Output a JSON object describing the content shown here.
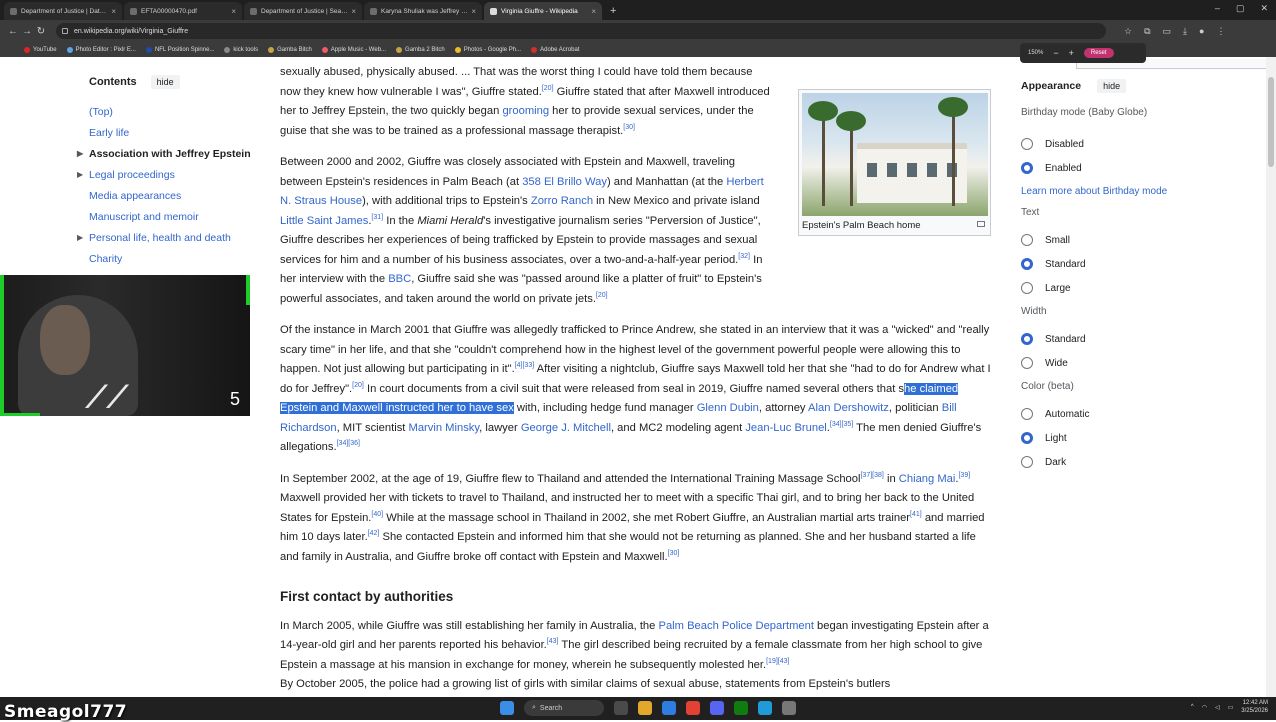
{
  "browser": {
    "tabs": [
      {
        "label": "Department of Justice | Data Set"
      },
      {
        "label": "EFTA00000470.pdf"
      },
      {
        "label": "Department of Justice | Search"
      },
      {
        "label": "Karyna Shuliak was Jeffrey Eps"
      },
      {
        "label": "Virginia Giuffre - Wikipedia",
        "active": true
      }
    ],
    "url": "en.wikipedia.org/wiki/Virginia_Giuffre",
    "bookmarks": [
      "YouTube",
      "Photo Editor : Pixlr E...",
      "NFL Position Spinne...",
      "kick tools",
      "Gamba Bitch",
      "Apple Music - Web...",
      "Gamba 2 Bitch",
      "Photos - Google Ph...",
      "Adobe Acrobat"
    ],
    "zoom": {
      "level": "150%",
      "minus": "−",
      "plus": "+",
      "reset": "Reset"
    }
  },
  "toc": {
    "title": "Contents",
    "hide": "hide",
    "items": [
      {
        "label": "(Top)"
      },
      {
        "label": "Early life"
      },
      {
        "label": "Association with Jeffrey Epstein",
        "current": true
      },
      {
        "label": "Legal proceedings"
      },
      {
        "label": "Media appearances"
      },
      {
        "label": "Manuscript and memoir"
      },
      {
        "label": "Personal life, health and death"
      },
      {
        "label": "Charity"
      }
    ]
  },
  "overlay": {
    "webcam_number": "5",
    "streamer_name": "Smeagol777"
  },
  "infobox": {
    "caption": "Epstein's Palm Beach home"
  },
  "article": {
    "p1": {
      "t1": "sexually abused, physically abused. ... That was the worst thing I could have told them because now they knew how vulnerable I was\", Giuffre stated.",
      "r1": "[20]",
      "t2": " Giuffre stated that after Maxwell introduced her to Jeffrey Epstein, the two quickly began ",
      "l1": "grooming",
      "t3": " her to provide sexual services, under the guise that she was to be trained as a professional massage therapist.",
      "r2": "[30]"
    },
    "p2": {
      "t1": "Between 2000 and 2002, Giuffre was closely associated with Epstein and Maxwell, traveling between Epstein's residences in Palm Beach (at ",
      "l1": "358 El Brillo Way",
      "t2": ") and Manhattan (at the ",
      "l2": "Herbert N. Straus House",
      "t3": "), with additional trips to Epstein's ",
      "l3": "Zorro Ranch",
      "t4": " in New Mexico and private island ",
      "l4": "Little Saint James",
      "t5": ".",
      "r1": "[31]",
      "t6": " In the ",
      "i1": "Miami Herald",
      "t7": "'s investigative journalism series \"Perversion of Justice\", Giuffre describes her experiences of being trafficked by Epstein to provide massages and sexual services for him and a number of his business associates, over a two-and-a-half-year period.",
      "r2": "[32]",
      "t8": " In her interview with the ",
      "l5": "BBC",
      "t9": ", Giuffre said she was \"passed around like a platter of fruit\" to Epstein's powerful associates, and taken around the world on private jets.",
      "r3": "[20]"
    },
    "p3": {
      "t1": "Of the instance in March 2001 that Giuffre was allegedly trafficked to Prince Andrew, she stated in an interview that it was a \"wicked\" and \"really scary time\" in her life, and that she \"couldn't comprehend how in the highest level of the government powerful people were allowing this to happen. Not just allowing but participating in it\".",
      "r1": "[4][33]",
      "t2": " After visiting a nightclub, Giuffre says Maxwell told her that she \"had to do for Andrew what I do for Jeffrey\".",
      "r2": "[20]",
      "t3": " In court documents from a civil suit that were released from seal in 2019, Giuffre named several others that s",
      "hl": "he claimed Epstein and Maxwell instructed her to have sex",
      "t4": " with, including hedge fund manager ",
      "l1": "Glenn Dubin",
      "t5": ", attorney ",
      "l2": "Alan Dershowitz",
      "t6": ", politician ",
      "l3": "Bill Richardson",
      "t7": ", MIT scientist ",
      "l4": "Marvin Minsky",
      "t8": ", lawyer ",
      "l5": "George J. Mitchell",
      "t9": ", and MC2 modeling agent ",
      "l6": "Jean-Luc Brunel",
      "t10": ".",
      "r3": "[34][35]",
      "t11": " The men denied Giuffre's allegations.",
      "r4": "[34][36]"
    },
    "p4": {
      "t1": "In September 2002, at the age of 19, Giuffre flew to Thailand and attended the International Training Massage School",
      "r1": "[37][38]",
      "t2": " in ",
      "l1": "Chiang Mai",
      "t3": ".",
      "r2": "[39]",
      "t4": " Maxwell provided her with tickets to travel to Thailand, and instructed her to meet with a specific Thai girl, and to bring her back to the United States for Epstein.",
      "r3": "[40]",
      "t5": " While at the massage school in Thailand in 2002, she met Robert Giuffre, an Australian martial arts trainer",
      "r4": "[41]",
      "t6": " and married him 10 days later.",
      "r5": "[42]",
      "t7": " She contacted Epstein and informed him that she would not be returning as planned. She and her husband started a life and family in Australia, and Giuffre broke off contact with Epstein and Maxwell.",
      "r6": "[30]"
    },
    "h2": "First contact by authorities",
    "p5": {
      "t1": "In March 2005, while Giuffre was still establishing her family in Australia, the ",
      "l1": "Palm Beach Police Department",
      "t2": " began investigating Epstein after a 14-year-old girl and her parents reported his behavior.",
      "r1": "[43]",
      "t3": " The girl described being recruited by a female classmate from her high school to give Epstein a massage at his mansion in exchange for money, wherein he subsequently molested her.",
      "r2": "[19][43]",
      "t4": " By October 2005, the police had a growing list of girls with similar claims of sexual abuse, statements from Epstein's butlers"
    }
  },
  "appearance": {
    "title": "Appearance",
    "hide": "hide",
    "birthday_label": "Birthday mode (Baby Globe)",
    "birthday_options": [
      {
        "label": "Disabled",
        "on": false
      },
      {
        "label": "Enabled",
        "on": true
      }
    ],
    "birthday_link": "Learn more about Birthday mode",
    "text_label": "Text",
    "text_options": [
      {
        "label": "Small",
        "on": false
      },
      {
        "label": "Standard",
        "on": true
      },
      {
        "label": "Large",
        "on": false
      }
    ],
    "width_label": "Width",
    "width_options": [
      {
        "label": "Standard",
        "on": true
      },
      {
        "label": "Wide",
        "on": false
      }
    ],
    "color_label": "Color (beta)",
    "color_options": [
      {
        "label": "Automatic",
        "on": false
      },
      {
        "label": "Light",
        "on": true
      },
      {
        "label": "Dark",
        "on": false
      }
    ]
  },
  "taskbar": {
    "search": "Search",
    "time": "12:42 AM",
    "date": "3/25/2026"
  }
}
